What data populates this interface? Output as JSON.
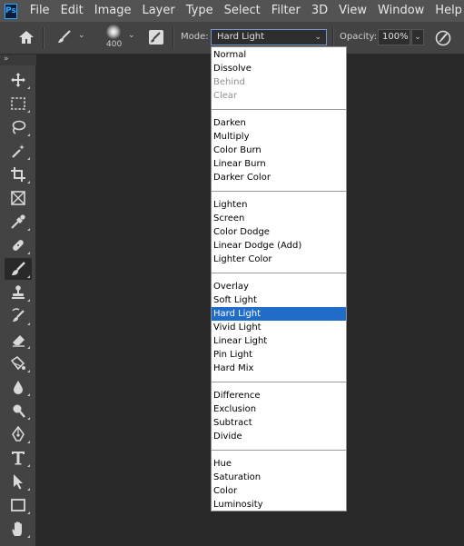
{
  "app": {
    "logo_text": "Ps"
  },
  "menu": [
    "File",
    "Edit",
    "Image",
    "Layer",
    "Type",
    "Select",
    "Filter",
    "3D",
    "View",
    "Window",
    "Help"
  ],
  "options": {
    "brush_size": "400",
    "mode_label": "Mode:",
    "mode_value": "Hard Light",
    "opacity_label": "Opacity:",
    "opacity_value": "100%"
  },
  "toolbar": {
    "collapse_glyph": "»",
    "tools": [
      "move-tool",
      "marquee-tool",
      "lasso-tool",
      "magic-wand-tool",
      "crop-tool",
      "frame-tool",
      "eyedropper-tool",
      "spot-healing-tool",
      "brush-tool",
      "clone-stamp-tool",
      "history-brush-tool",
      "eraser-tool",
      "gradient-tool",
      "blur-tool",
      "dodge-tool",
      "pen-tool",
      "type-tool",
      "path-selection-tool",
      "rectangle-tool",
      "hand-tool"
    ],
    "active_tool": "brush-tool"
  },
  "blend_modes": {
    "groups": [
      [
        {
          "label": "Normal"
        },
        {
          "label": "Dissolve"
        },
        {
          "label": "Behind",
          "disabled": true
        },
        {
          "label": "Clear",
          "disabled": true
        }
      ],
      [
        {
          "label": "Darken"
        },
        {
          "label": "Multiply"
        },
        {
          "label": "Color Burn"
        },
        {
          "label": "Linear Burn"
        },
        {
          "label": "Darker Color"
        }
      ],
      [
        {
          "label": "Lighten"
        },
        {
          "label": "Screen"
        },
        {
          "label": "Color Dodge"
        },
        {
          "label": "Linear Dodge (Add)"
        },
        {
          "label": "Lighter Color"
        }
      ],
      [
        {
          "label": "Overlay"
        },
        {
          "label": "Soft Light"
        },
        {
          "label": "Hard Light",
          "selected": true
        },
        {
          "label": "Vivid Light"
        },
        {
          "label": "Linear Light"
        },
        {
          "label": "Pin Light"
        },
        {
          "label": "Hard Mix"
        }
      ],
      [
        {
          "label": "Difference"
        },
        {
          "label": "Exclusion"
        },
        {
          "label": "Subtract"
        },
        {
          "label": "Divide"
        }
      ],
      [
        {
          "label": "Hue"
        },
        {
          "label": "Saturation"
        },
        {
          "label": "Color"
        },
        {
          "label": "Luminosity"
        }
      ]
    ]
  },
  "colors": {
    "selection": "#1f6cc9",
    "menubar": "#535353",
    "panel": "#434343",
    "canvas": "#282828"
  }
}
